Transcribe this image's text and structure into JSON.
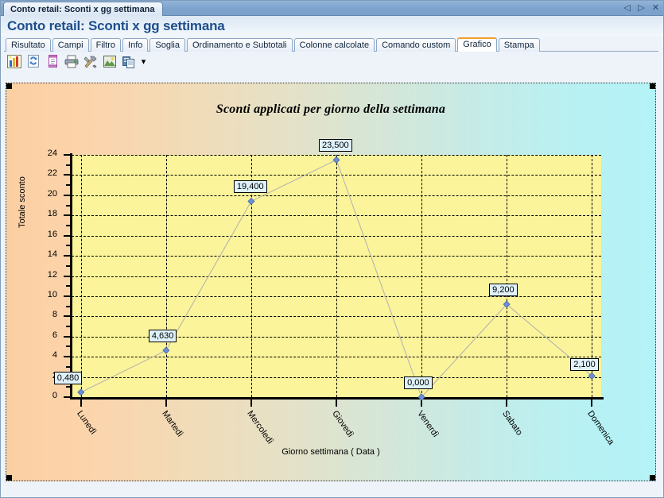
{
  "window": {
    "document_tab": "Conto retail: Sconti x gg settimana",
    "heading": "Conto retail: Sconti x gg settimana",
    "controls": [
      {
        "name": "prev-document-button",
        "glyph": "◁"
      },
      {
        "name": "next-document-button",
        "glyph": "▷"
      },
      {
        "name": "close-document-button",
        "glyph": "✕"
      }
    ]
  },
  "tabs": [
    {
      "label": "Risultato",
      "active": false
    },
    {
      "label": "Campi",
      "active": false
    },
    {
      "label": "Filtro",
      "active": false
    },
    {
      "label": "Info",
      "active": false
    },
    {
      "label": "Soglia",
      "active": false
    },
    {
      "label": "Ordinamento e Subtotali",
      "active": false
    },
    {
      "label": "Colonne calcolate",
      "active": false
    },
    {
      "label": "Comando custom",
      "active": false
    },
    {
      "label": "Grafico",
      "active": true
    },
    {
      "label": "Stampa",
      "active": false
    }
  ],
  "toolbar": {
    "items": [
      {
        "name": "chart-icon",
        "title": "Grafico"
      },
      {
        "name": "refresh-icon",
        "title": "Aggiorna"
      },
      {
        "name": "page-icon",
        "title": "Pagina"
      },
      {
        "name": "print-icon",
        "title": "Stampa"
      },
      {
        "name": "tools-icon",
        "title": "Strumenti"
      },
      {
        "name": "image-export-icon",
        "title": "Esporta immagine"
      },
      {
        "name": "copy-icon",
        "title": "Copia"
      }
    ],
    "caret": "▾"
  },
  "chart_data": {
    "type": "line",
    "title": "Sconti applicati per giorno della settimana",
    "xlabel": "Giorno settimana ( Data )",
    "ylabel": "Totale sconto",
    "categories": [
      "Lunedì",
      "Martedì",
      "Mercoledì",
      "Giovedì",
      "Venerdì",
      "Sabato",
      "Domenica"
    ],
    "values": [
      0.48,
      4.63,
      19.4,
      23.5,
      0.0,
      9.2,
      2.1
    ],
    "point_labels": [
      "0,480",
      "4,630",
      "19,400",
      "23,500",
      "0,000",
      "9,200",
      "2,100"
    ],
    "ylim": [
      0,
      24
    ],
    "yticks": [
      0,
      2,
      4,
      6,
      8,
      10,
      12,
      14,
      16,
      18,
      20,
      22,
      24
    ],
    "ytick_labels": [
      "0",
      "2",
      "4",
      "6",
      "8",
      "10",
      "12",
      "14",
      "16",
      "18",
      "20",
      "22",
      "24"
    ],
    "grid": true,
    "legend": false,
    "colors": {
      "plot_background": "#fbf49a",
      "marker": "#6b8fd4",
      "line": "#b0b0b0",
      "label_background": "#dff2fb",
      "panel_gradient_start": "#fbcfa2",
      "panel_gradient_end": "#b3f3f7",
      "accent": "#f0a030"
    }
  }
}
